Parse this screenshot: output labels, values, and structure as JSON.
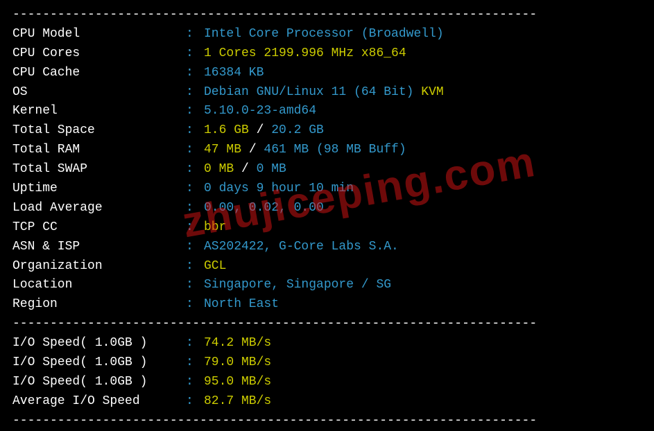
{
  "divider": "----------------------------------------------------------------------",
  "sysinfo": {
    "cpu_model": {
      "label": "CPU Model            ",
      "value": "Intel Core Processor (Broadwell)"
    },
    "cpu_cores": {
      "label": "CPU Cores            ",
      "value": "1 Cores 2199.996 MHz x86_64"
    },
    "cpu_cache": {
      "label": "CPU Cache            ",
      "value": "16384 KB"
    },
    "os": {
      "label": "OS                   ",
      "value": "Debian GNU/Linux 11 (64 Bit) ",
      "suffix": "KVM"
    },
    "kernel": {
      "label": "Kernel               ",
      "value": "5.10.0-23-amd64"
    },
    "total_space": {
      "label": "Total Space          ",
      "used": "1.6 GB",
      "sep": " / ",
      "total": "20.2 GB"
    },
    "total_ram": {
      "label": "Total RAM            ",
      "used": "47 MB",
      "sep": " / ",
      "total": "461 MB",
      "buff": " (98 MB Buff)"
    },
    "total_swap": {
      "label": "Total SWAP           ",
      "used": "0 MB",
      "sep": " / ",
      "total": "0 MB"
    },
    "uptime": {
      "label": "Uptime               ",
      "value": "0 days 9 hour 10 min"
    },
    "load_avg": {
      "label": "Load Average         ",
      "value": "0.00, 0.02, 0.00"
    },
    "tcp_cc": {
      "label": "TCP CC               ",
      "value": "bbr"
    },
    "asn_isp": {
      "label": "ASN & ISP            ",
      "value": "AS202422, G-Core Labs S.A."
    },
    "organization": {
      "label": "Organization         ",
      "value": "GCL"
    },
    "location": {
      "label": "Location             ",
      "value": "Singapore, Singapore / SG"
    },
    "region": {
      "label": "Region               ",
      "value": "North East"
    }
  },
  "iospeed": {
    "rows": [
      {
        "label": "I/O Speed( 1.0GB )   ",
        "value": "74.2 MB/s"
      },
      {
        "label": "I/O Speed( 1.0GB )   ",
        "value": "79.0 MB/s"
      },
      {
        "label": "I/O Speed( 1.0GB )   ",
        "value": "95.0 MB/s"
      }
    ],
    "average": {
      "label": "Average I/O Speed    ",
      "value": "82.7 MB/s"
    }
  },
  "watermark": "zhujiceping.com"
}
